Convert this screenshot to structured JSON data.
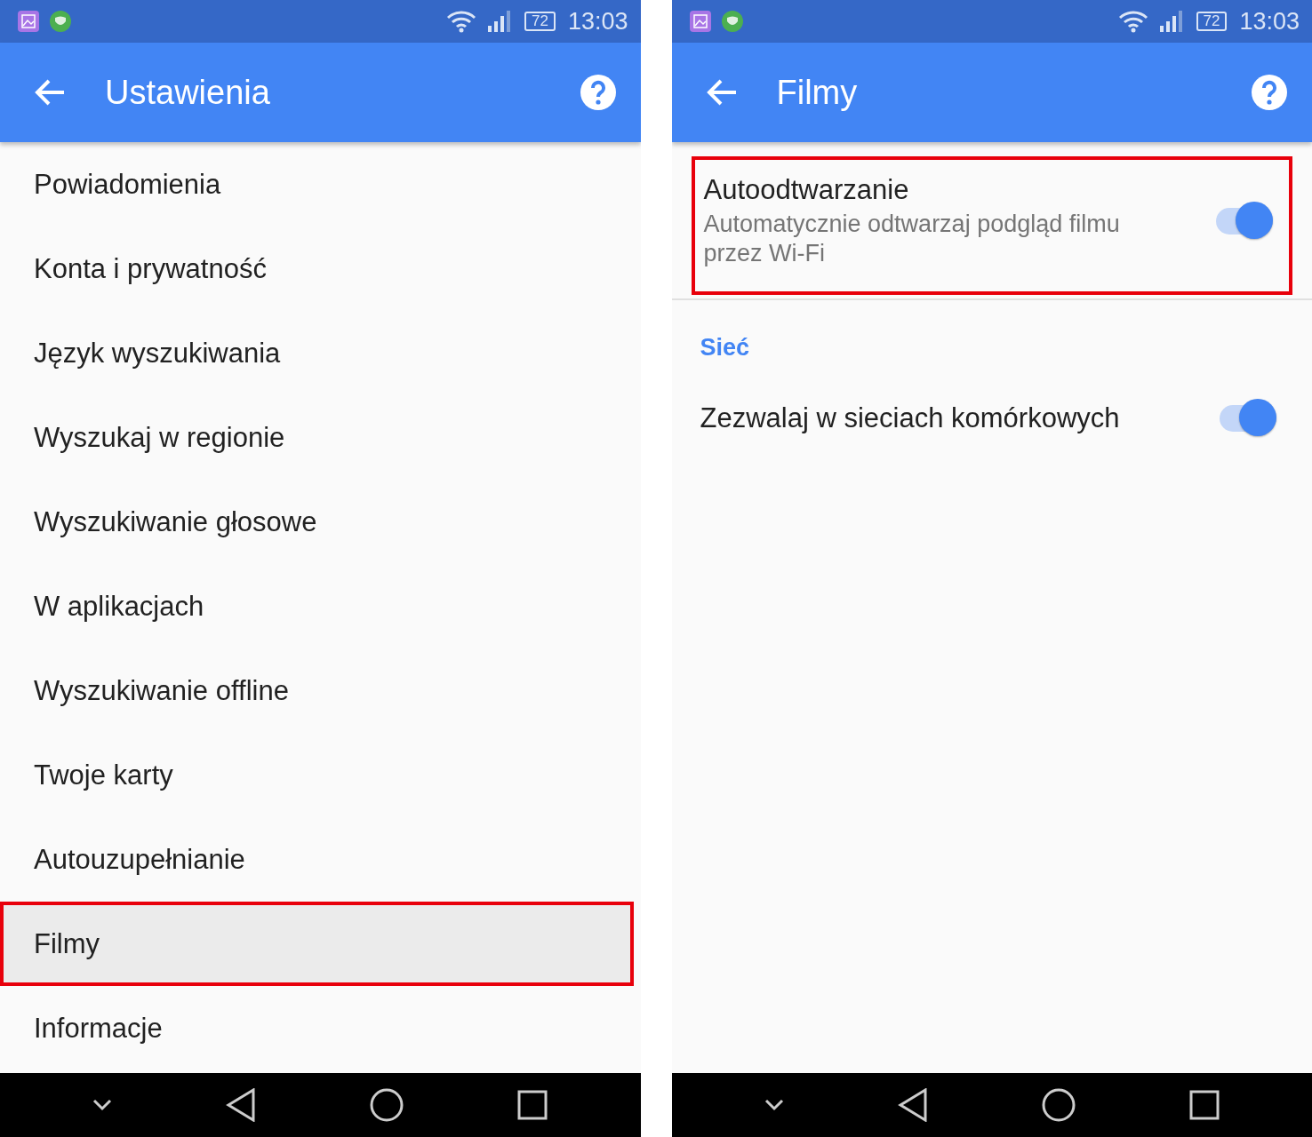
{
  "screens": [
    {
      "kind": "list",
      "status_bar": {
        "battery": "72",
        "time": "13:03"
      },
      "app_bar": {
        "title": "Ustawienia"
      },
      "items": [
        {
          "label": "Powiadomienia",
          "selected": false,
          "outlined": false
        },
        {
          "label": "Konta i prywatność",
          "selected": false,
          "outlined": false
        },
        {
          "label": "Język wyszukiwania",
          "selected": false,
          "outlined": false
        },
        {
          "label": "Wyszukaj w regionie",
          "selected": false,
          "outlined": false
        },
        {
          "label": "Wyszukiwanie głosowe",
          "selected": false,
          "outlined": false
        },
        {
          "label": "W aplikacjach",
          "selected": false,
          "outlined": false
        },
        {
          "label": "Wyszukiwanie offline",
          "selected": false,
          "outlined": false
        },
        {
          "label": "Twoje karty",
          "selected": false,
          "outlined": false
        },
        {
          "label": "Autouzupełnianie",
          "selected": false,
          "outlined": false
        },
        {
          "label": "Filmy",
          "selected": true,
          "outlined": true
        },
        {
          "label": "Informacje",
          "selected": false,
          "outlined": false
        }
      ]
    },
    {
      "kind": "prefs",
      "status_bar": {
        "battery": "72",
        "time": "13:03"
      },
      "app_bar": {
        "title": "Filmy"
      },
      "preferences": [
        {
          "kind": "toggle",
          "title": "Autoodtwarzanie",
          "summary": "Automatycznie odtwarzaj podgląd filmu przez Wi-Fi",
          "on": true,
          "outlined": true
        },
        {
          "kind": "header",
          "title": "Sieć"
        },
        {
          "kind": "toggle",
          "title": "Zezwalaj w sieciach komórkowych",
          "on": true,
          "outlined": false
        }
      ]
    }
  ]
}
